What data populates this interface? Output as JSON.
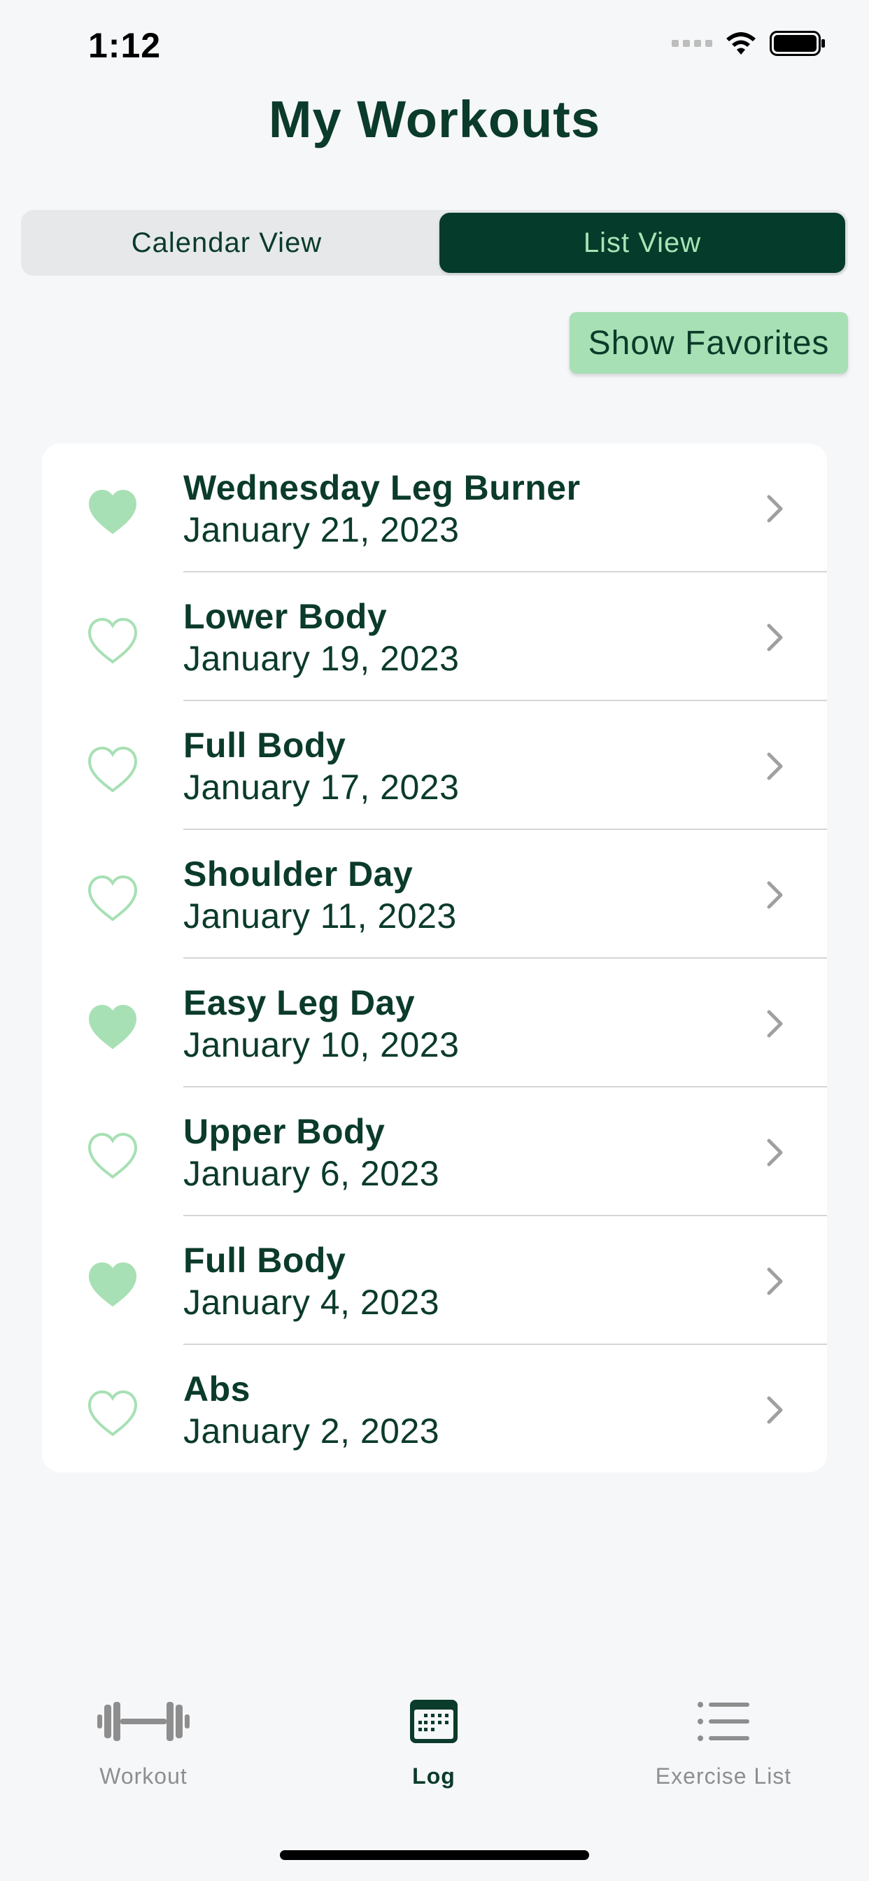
{
  "status_bar": {
    "time": "1:12"
  },
  "header": {
    "title": "My Workouts"
  },
  "view_toggle": {
    "options": [
      "Calendar View",
      "List View"
    ],
    "selected": "List View"
  },
  "filter": {
    "favorites_label": "Show Favorites"
  },
  "workouts": [
    {
      "name": "Wednesday Leg Burner",
      "date": "January 21, 2023",
      "favorite": true
    },
    {
      "name": "Lower Body",
      "date": "January 19, 2023",
      "favorite": false
    },
    {
      "name": "Full Body",
      "date": "January 17, 2023",
      "favorite": false
    },
    {
      "name": "Shoulder Day",
      "date": "January 11, 2023",
      "favorite": false
    },
    {
      "name": "Easy Leg Day",
      "date": "January 10, 2023",
      "favorite": true
    },
    {
      "name": "Upper Body",
      "date": "January 6, 2023",
      "favorite": false
    },
    {
      "name": "Full Body",
      "date": "January 4, 2023",
      "favorite": true
    },
    {
      "name": "Abs",
      "date": "January 2, 2023",
      "favorite": false
    }
  ],
  "tab_bar": {
    "tabs": [
      {
        "label": "Workout",
        "icon": "dumbbell-icon",
        "active": false
      },
      {
        "label": "Log",
        "icon": "calendar-icon",
        "active": true
      },
      {
        "label": "Exercise List",
        "icon": "list-icon",
        "active": false
      }
    ]
  },
  "colors": {
    "primary_dark": "#043b2a",
    "accent_green": "#a7e0b4",
    "text": "#0b3b2a",
    "background": "#f6f7f9"
  }
}
